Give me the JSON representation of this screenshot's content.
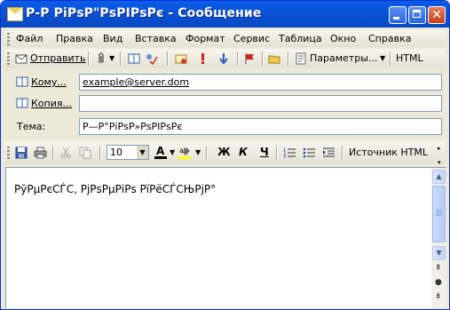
{
  "window": {
    "title": "Р-Р РiРsР\"РsРIРsРє - Сообщение"
  },
  "menubar": {
    "items": [
      {
        "label": "Файл",
        "key": "file"
      },
      {
        "label": "Правка",
        "key": "edit"
      },
      {
        "label": "Вид",
        "key": "view"
      },
      {
        "label": "Вставка",
        "key": "insert"
      },
      {
        "label": "Формат",
        "key": "format"
      },
      {
        "label": "Сервис",
        "key": "tools"
      },
      {
        "label": "Таблица",
        "key": "table"
      },
      {
        "label": "Окно",
        "key": "window"
      },
      {
        "label": "Справка",
        "key": "help"
      }
    ]
  },
  "toolbar": {
    "send_label": "Отправить",
    "options_label": "Параметры...",
    "format_label": "HTML"
  },
  "fields": {
    "to_label": "Кому...",
    "to_value": "example@server.dom",
    "cc_label": "Копия...",
    "cc_value": "",
    "subject_label": "Тема:",
    "subject_value": "Р—Р°РіРsР»РsРІРsРє"
  },
  "format_toolbar": {
    "font_size": "10",
    "bold_label": "Ж",
    "italic_label": "К",
    "underline_label": "Ч",
    "html_source_label": "Источник HTML"
  },
  "message": {
    "body": "РўРµРєСЃС‚ РјРѕРµРіРѕ РїРёСЃСЊРјР°"
  },
  "colors": {
    "titlebar": "#0a53d6",
    "close_button": "#c6401b",
    "chrome": "#ece9d8"
  }
}
